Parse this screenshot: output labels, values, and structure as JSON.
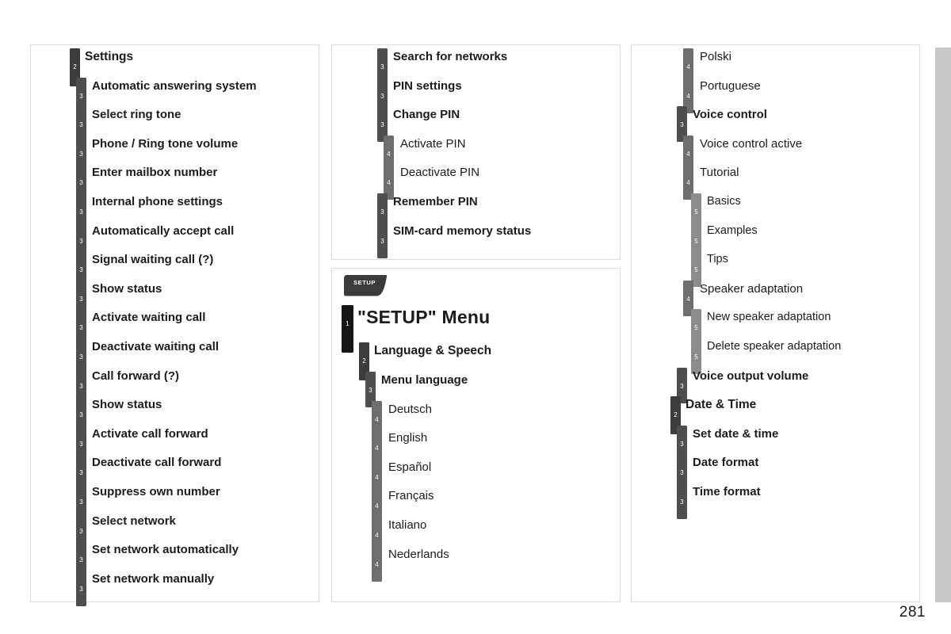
{
  "page": {
    "number": "281",
    "accent_dark": "#151515",
    "level_colors": {
      "1": "#151515",
      "2": "#3c3c3c",
      "3": "#4e4e4e",
      "4": "#6e6e6e",
      "5": "#8c8c8c"
    }
  },
  "panels": {
    "left": {
      "items": [
        {
          "level": 2,
          "label": "Settings"
        },
        {
          "level": 3,
          "label": "Automatic answering system"
        },
        {
          "level": 3,
          "label": "Select ring tone"
        },
        {
          "level": 3,
          "label": "Phone / Ring tone volume"
        },
        {
          "level": 3,
          "label": "Enter mailbox number"
        },
        {
          "level": 3,
          "label": "Internal phone settings"
        },
        {
          "level": 3,
          "label": "Automatically accept call"
        },
        {
          "level": 3,
          "label": "Signal waiting call (?)"
        },
        {
          "level": 3,
          "label": "Show status"
        },
        {
          "level": 3,
          "label": "Activate waiting call"
        },
        {
          "level": 3,
          "label": "Deactivate waiting call"
        },
        {
          "level": 3,
          "label": "Call forward (?)"
        },
        {
          "level": 3,
          "label": "Show status"
        },
        {
          "level": 3,
          "label": "Activate call forward"
        },
        {
          "level": 3,
          "label": "Deactivate call forward"
        },
        {
          "level": 3,
          "label": "Suppress own number"
        },
        {
          "level": 3,
          "label": "Select network"
        },
        {
          "level": 3,
          "label": "Set network automatically"
        },
        {
          "level": 3,
          "label": "Set network manually"
        }
      ]
    },
    "mid_top": {
      "items": [
        {
          "level": 3,
          "label": "Search for networks"
        },
        {
          "level": 3,
          "label": "PIN settings"
        },
        {
          "level": 3,
          "label": "Change PIN"
        },
        {
          "level": 4,
          "label": "Activate PIN"
        },
        {
          "level": 4,
          "label": "Deactivate PIN"
        },
        {
          "level": 3,
          "label": "Remember PIN"
        },
        {
          "level": 3,
          "label": "SIM-card memory status"
        }
      ]
    },
    "mid_bottom": {
      "tab_label": "SETUP",
      "items": [
        {
          "level": 1,
          "label": "\"SETUP\" Menu"
        },
        {
          "level": 2,
          "label": "Language & Speech"
        },
        {
          "level": 3,
          "label": "Menu language"
        },
        {
          "level": 4,
          "label": "Deutsch"
        },
        {
          "level": 4,
          "label": "English"
        },
        {
          "level": 4,
          "label": "Español"
        },
        {
          "level": 4,
          "label": "Français"
        },
        {
          "level": 4,
          "label": "Italiano"
        },
        {
          "level": 4,
          "label": "Nederlands"
        }
      ]
    },
    "right": {
      "items": [
        {
          "level": 4,
          "label": "Polski"
        },
        {
          "level": 4,
          "label": "Portuguese"
        },
        {
          "level": 3,
          "label": "Voice control"
        },
        {
          "level": 4,
          "label": "Voice control active"
        },
        {
          "level": 4,
          "label": "Tutorial"
        },
        {
          "level": 5,
          "label": "Basics"
        },
        {
          "level": 5,
          "label": "Examples"
        },
        {
          "level": 5,
          "label": "Tips"
        },
        {
          "level": 4,
          "label": "Speaker adaptation"
        },
        {
          "level": 5,
          "label": "New speaker adaptation"
        },
        {
          "level": 5,
          "label": "Delete speaker adaptation"
        },
        {
          "level": 3,
          "label": "Voice output volume"
        },
        {
          "level": 2,
          "label": "Date & Time"
        },
        {
          "level": 3,
          "label": "Set date & time"
        },
        {
          "level": 3,
          "label": "Date format"
        },
        {
          "level": 3,
          "label": "Time format"
        }
      ]
    }
  }
}
